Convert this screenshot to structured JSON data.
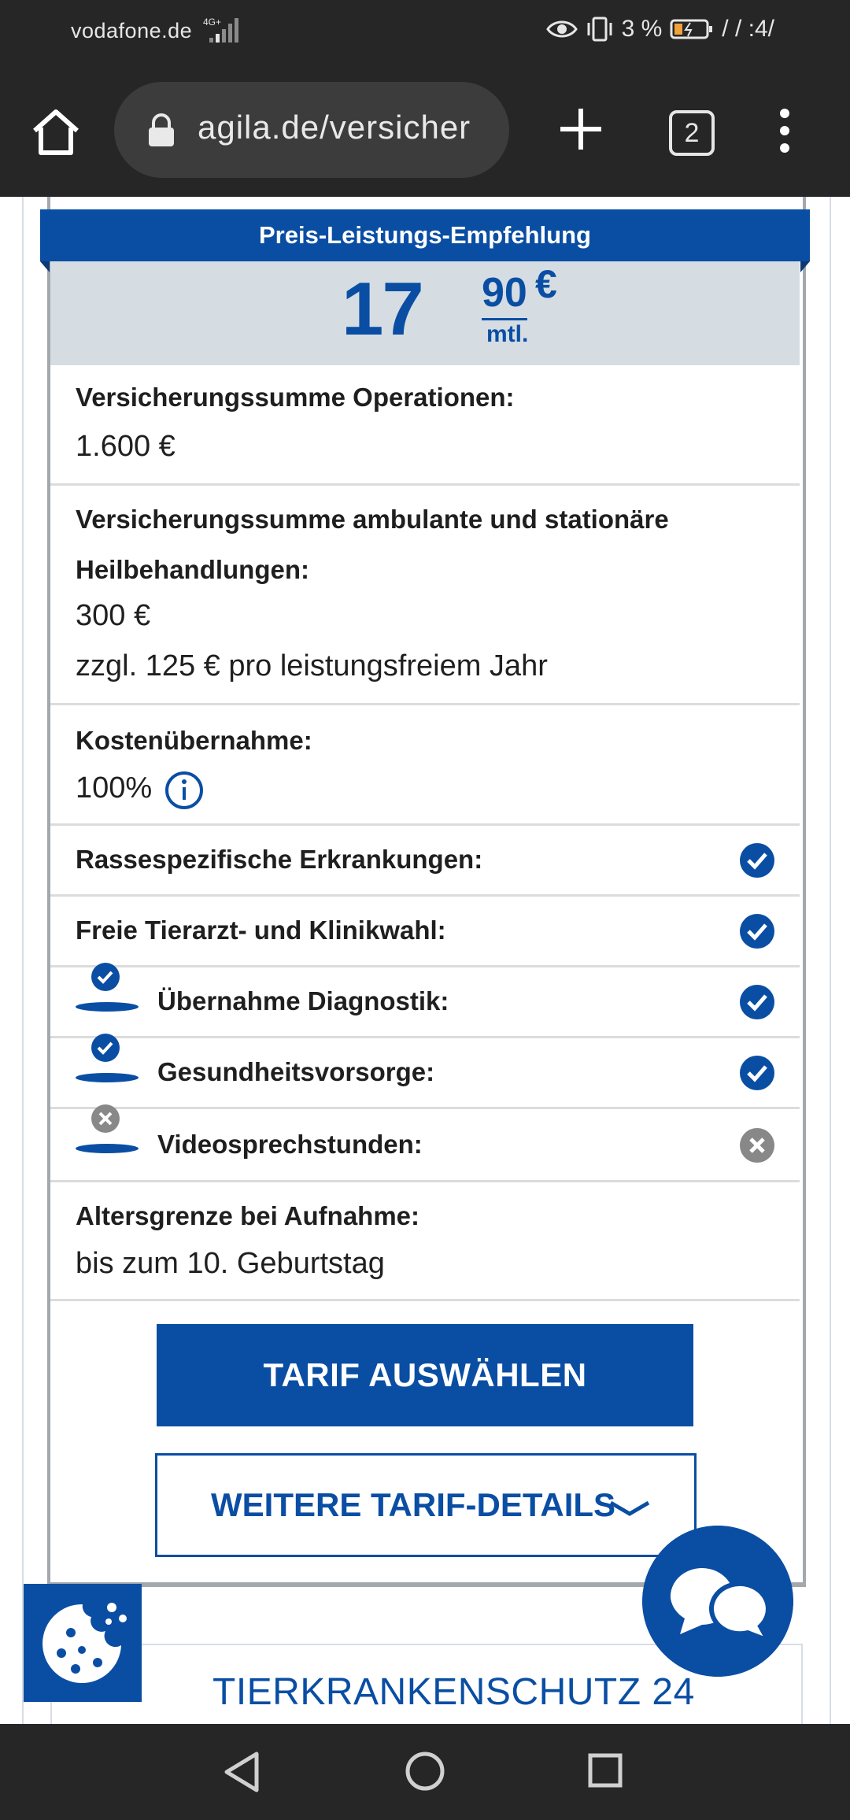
{
  "status_bar": {
    "carrier": "vodafone.de",
    "network": "4G+",
    "battery_text": "3 %",
    "time": "/ / :4/"
  },
  "browser": {
    "url": "agila.de/versicher",
    "tab_count": "2"
  },
  "card": {
    "ribbon": "Preis-Leistungs-Empfehlung",
    "price_main": "17",
    "price_cents": "90",
    "price_currency": "€",
    "price_period": "mtl.",
    "rows": [
      {
        "label": "Versicherungssumme Operationen:",
        "value": "1.600 €"
      },
      {
        "label_line1": "Versicherungssumme ambulante und stationäre",
        "label_line2": "Heilbehandlungen:",
        "value_line1": "300 €",
        "value_line2": "zzgl. 125 € pro leistungsfreiem Jahr"
      },
      {
        "label": "Kostenübernahme:",
        "value": "100%"
      },
      {
        "label": "Rassespezifische Erkrankungen:",
        "included": true
      },
      {
        "label": "Freie Tierarzt- und Klinikwahl:",
        "included": true
      },
      {
        "label": "Übernahme Diagnostik:",
        "included": true
      },
      {
        "label": "Gesundheitsvorsorge:",
        "included": true
      },
      {
        "label": "Videosprechstunden:",
        "included": false
      },
      {
        "label": "Altersgrenze bei Aufnahme:",
        "value": "bis zum 10. Geburtstag"
      }
    ],
    "select_button": "TARIF AUSWÄHLEN",
    "details_button": "WEITERE TARIF-DETAILS"
  },
  "next_card_title": "TIERKRANKENSCHUTZ 24",
  "colors": {
    "brand_blue": "#0a4ea4",
    "check_excluded": "#888888",
    "price_bg": "#d5dde3"
  },
  "icons": [
    "home-icon",
    "lock-icon",
    "plus-icon",
    "tabs-icon",
    "more-vert-icon",
    "info-icon",
    "check-circle-icon",
    "x-circle-icon",
    "cookie-icon",
    "chat-icon",
    "back-icon",
    "home-circle-icon",
    "recents-icon"
  ]
}
